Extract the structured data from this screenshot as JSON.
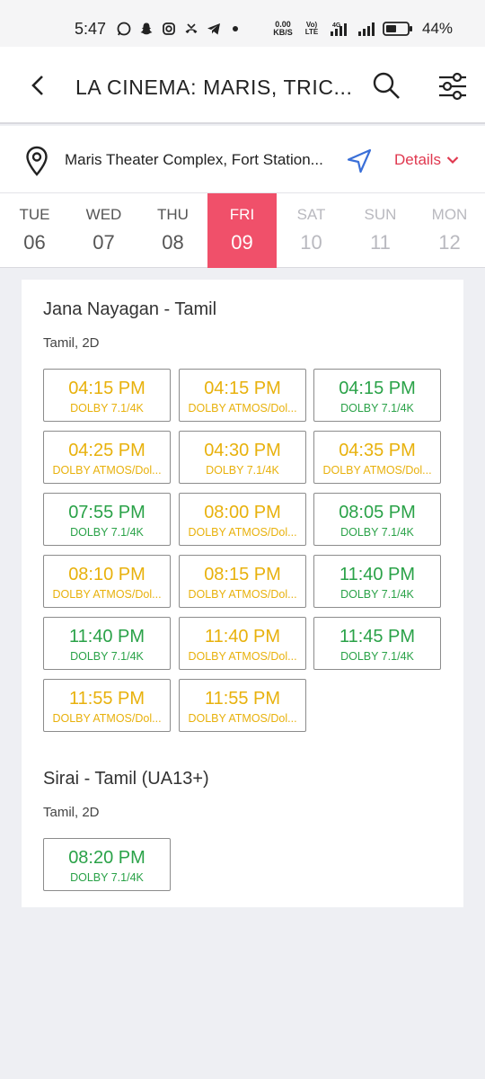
{
  "status_bar": {
    "time": "5:47",
    "speed_value": "0.00",
    "speed_unit": "KB/S",
    "volte_top": "Vo)",
    "volte_bottom": "LTE",
    "network": "4G",
    "battery": "44%"
  },
  "header": {
    "title": "LA CINEMA: MARIS, TRIC..."
  },
  "venue": {
    "name": "Maris Theater Complex, Fort Station...",
    "details_label": "Details"
  },
  "dates": [
    {
      "dow": "TUE",
      "num": "06",
      "state": "normal"
    },
    {
      "dow": "WED",
      "num": "07",
      "state": "normal"
    },
    {
      "dow": "THU",
      "num": "08",
      "state": "normal"
    },
    {
      "dow": "FRI",
      "num": "09",
      "state": "selected"
    },
    {
      "dow": "SAT",
      "num": "10",
      "state": "disabled"
    },
    {
      "dow": "SUN",
      "num": "11",
      "state": "disabled"
    },
    {
      "dow": "MON",
      "num": "12",
      "state": "disabled"
    }
  ],
  "movies": [
    {
      "title": "Jana Nayagan - Tamil",
      "meta": "Tamil, 2D",
      "shows": [
        {
          "time": "04:15 PM",
          "format": "DOLBY 7.1/4K",
          "color": "yellow"
        },
        {
          "time": "04:15 PM",
          "format": "DOLBY ATMOS/Dol...",
          "color": "yellow"
        },
        {
          "time": "04:15 PM",
          "format": "DOLBY 7.1/4K",
          "color": "green"
        },
        {
          "time": "04:25 PM",
          "format": "DOLBY ATMOS/Dol...",
          "color": "yellow"
        },
        {
          "time": "04:30 PM",
          "format": "DOLBY 7.1/4K",
          "color": "yellow"
        },
        {
          "time": "04:35 PM",
          "format": "DOLBY ATMOS/Dol...",
          "color": "yellow"
        },
        {
          "time": "07:55 PM",
          "format": "DOLBY 7.1/4K",
          "color": "green"
        },
        {
          "time": "08:00 PM",
          "format": "DOLBY ATMOS/Dol...",
          "color": "yellow"
        },
        {
          "time": "08:05 PM",
          "format": "DOLBY 7.1/4K",
          "color": "green"
        },
        {
          "time": "08:10 PM",
          "format": "DOLBY ATMOS/Dol...",
          "color": "yellow"
        },
        {
          "time": "08:15 PM",
          "format": "DOLBY ATMOS/Dol...",
          "color": "yellow"
        },
        {
          "time": "11:40 PM",
          "format": "DOLBY 7.1/4K",
          "color": "green"
        },
        {
          "time": "11:40 PM",
          "format": "DOLBY 7.1/4K",
          "color": "green"
        },
        {
          "time": "11:40 PM",
          "format": "DOLBY ATMOS/Dol...",
          "color": "yellow"
        },
        {
          "time": "11:45 PM",
          "format": "DOLBY 7.1/4K",
          "color": "green"
        },
        {
          "time": "11:55 PM",
          "format": "DOLBY ATMOS/Dol...",
          "color": "yellow"
        },
        {
          "time": "11:55 PM",
          "format": "DOLBY ATMOS/Dol...",
          "color": "yellow"
        }
      ]
    },
    {
      "title": "Sirai - Tamil (UA13+)",
      "meta": "Tamil, 2D",
      "shows": [
        {
          "time": "08:20 PM",
          "format": "DOLBY 7.1/4K",
          "color": "green"
        }
      ]
    }
  ],
  "colors": {
    "accent": "#f0506a",
    "available": "#2aa248",
    "filling_fast": "#e8b10c"
  }
}
